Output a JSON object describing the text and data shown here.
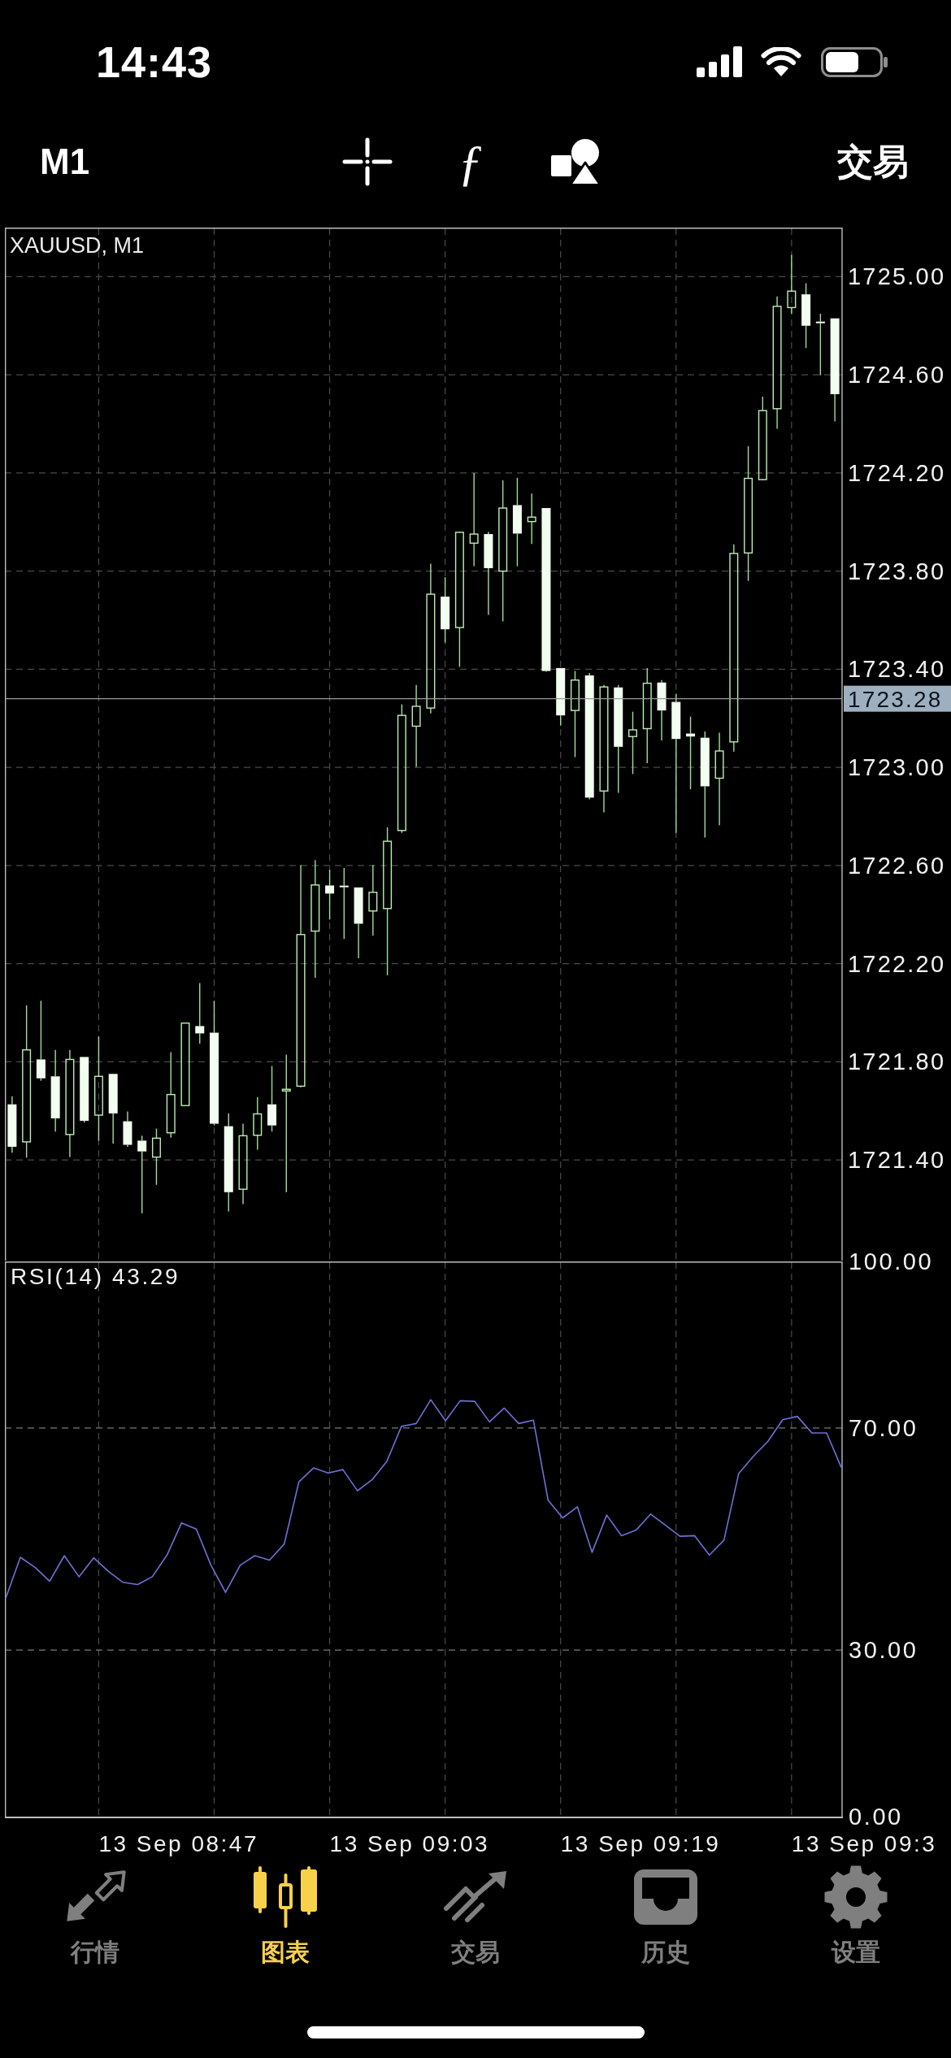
{
  "status_bar": {
    "time": "14:43"
  },
  "toolbar": {
    "timeframe": "M1",
    "function_glyph": "ƒ",
    "trade": "交易"
  },
  "chart": {
    "chart_data": {
      "type": "candlestick",
      "title": "XAUUSD, M1",
      "grid": true,
      "ylim": [
        1720.99,
        1725.2
      ],
      "yticks": [
        {
          "value": 1725.0,
          "label": "1725.00"
        },
        {
          "value": 1724.6,
          "label": "1724.60"
        },
        {
          "value": 1724.2,
          "label": "1724.20"
        },
        {
          "value": 1723.8,
          "label": "1723.80"
        },
        {
          "value": 1723.4,
          "label": "1723.40"
        },
        {
          "value": 1723.0,
          "label": "1723.00"
        },
        {
          "value": 1722.6,
          "label": "1722.60"
        },
        {
          "value": 1722.2,
          "label": "1722.20"
        },
        {
          "value": 1721.8,
          "label": "1721.80"
        },
        {
          "value": 1721.4,
          "label": "1721.40"
        }
      ],
      "ohlc": [
        [
          1721.627,
          1721.66,
          1721.43,
          1721.454
        ],
        [
          1721.474,
          1722.03,
          1721.41,
          1721.849
        ],
        [
          1721.81,
          1722.049,
          1721.723,
          1721.733
        ],
        [
          1721.741,
          1721.849,
          1721.516,
          1721.57
        ],
        [
          1721.504,
          1721.849,
          1721.412,
          1721.81
        ],
        [
          1721.82,
          1721.82,
          1721.553,
          1721.56
        ],
        [
          1721.583,
          1721.904,
          1721.479,
          1721.741
        ],
        [
          1721.751,
          1721.751,
          1721.467,
          1721.59
        ],
        [
          1721.558,
          1721.598,
          1721.454,
          1721.462
        ],
        [
          1721.479,
          1721.499,
          1721.183,
          1721.435
        ],
        [
          1721.412,
          1721.528,
          1721.299,
          1721.489
        ],
        [
          1721.511,
          1721.84,
          1721.491,
          1721.667
        ],
        [
          1721.622,
          1721.958,
          1721.622,
          1721.958
        ],
        [
          1721.946,
          1722.121,
          1721.874,
          1721.916
        ],
        [
          1721.919,
          1722.049,
          1721.541,
          1721.548
        ],
        [
          1721.538,
          1721.59,
          1721.19,
          1721.269
        ],
        [
          1721.281,
          1721.548,
          1721.22,
          1721.499
        ],
        [
          1721.501,
          1721.657,
          1721.442,
          1721.588
        ],
        [
          1721.627,
          1721.783,
          1721.516,
          1721.541
        ],
        [
          1721.683,
          1721.83,
          1721.269,
          1721.687
        ],
        [
          1721.701,
          1722.602,
          1721.696,
          1722.319
        ],
        [
          1722.333,
          1722.622,
          1722.143,
          1722.521
        ],
        [
          1722.519,
          1722.583,
          1722.38,
          1722.486
        ],
        [
          1722.516,
          1722.59,
          1722.301,
          1722.514
        ],
        [
          1722.511,
          1722.511,
          1722.222,
          1722.363
        ],
        [
          1722.415,
          1722.602,
          1722.314,
          1722.491
        ],
        [
          1722.425,
          1722.756,
          1722.153,
          1722.699
        ],
        [
          1722.743,
          1723.257,
          1722.733,
          1723.212
        ],
        [
          1723.168,
          1723.336,
          1723.002,
          1723.249
        ],
        [
          1723.242,
          1723.83,
          1723.22,
          1723.706
        ],
        [
          1723.696,
          1723.775,
          1723.509,
          1723.563
        ],
        [
          1723.57,
          1723.961,
          1723.41,
          1723.958
        ],
        [
          1723.914,
          1724.2,
          1723.82,
          1723.951
        ],
        [
          1723.951,
          1723.96,
          1723.622,
          1723.812
        ],
        [
          1723.8,
          1724.17,
          1723.595,
          1724.057
        ],
        [
          1724.069,
          1724.18,
          1723.82,
          1723.953
        ],
        [
          1724.002,
          1724.116,
          1723.911,
          1724.02
        ],
        [
          1724.057,
          1724.057,
          1723.39,
          1723.393
        ],
        [
          1723.405,
          1723.405,
          1723.17,
          1723.212
        ],
        [
          1723.232,
          1723.393,
          1723.042,
          1723.356
        ],
        [
          1723.375,
          1723.385,
          1722.87,
          1722.877
        ],
        [
          1722.904,
          1723.336,
          1722.817,
          1723.328
        ],
        [
          1723.326,
          1723.336,
          1722.896,
          1723.084
        ],
        [
          1723.126,
          1723.227,
          1722.973,
          1723.153
        ],
        [
          1723.158,
          1723.405,
          1723.017,
          1723.343
        ],
        [
          1723.346,
          1723.356,
          1723.11,
          1723.232
        ],
        [
          1723.267,
          1723.3,
          1722.733,
          1723.116
        ],
        [
          1723.138,
          1723.207,
          1722.911,
          1723.126
        ],
        [
          1723.121,
          1723.146,
          1722.714,
          1722.923
        ],
        [
          1722.956,
          1723.141,
          1722.765,
          1723.067
        ],
        [
          1723.104,
          1723.909,
          1723.064,
          1723.872
        ],
        [
          1723.874,
          1724.309,
          1723.76,
          1724.178
        ],
        [
          1724.173,
          1724.511,
          1724.17,
          1724.454
        ],
        [
          1724.462,
          1724.919,
          1724.38,
          1724.879
        ],
        [
          1724.874,
          1725.089,
          1724.849,
          1724.941
        ],
        [
          1724.928,
          1724.973,
          1724.709,
          1724.8
        ],
        [
          1724.815,
          1724.849,
          1724.598,
          1724.812
        ],
        [
          1724.83,
          1724.83,
          1724.41,
          1724.521
        ]
      ],
      "ref_lines": [
        {
          "axis": "y",
          "value": 1723.28,
          "label": "1723.28"
        }
      ]
    }
  },
  "indicator": {
    "chart_data": {
      "type": "line",
      "title": "RSI(14) 43.29",
      "grid": true,
      "ylim": [
        0,
        100
      ],
      "yticks": [
        {
          "value": 100,
          "label": "100.00"
        },
        {
          "value": 70,
          "label": "70.00"
        },
        {
          "value": 30,
          "label": "30.00"
        },
        {
          "value": 0,
          "label": "0.00"
        }
      ],
      "series": [
        {
          "color": "#6d72d9",
          "values": [
            39.3,
            46.7,
            44.9,
            42.4,
            47.0,
            43.2,
            46.6,
            44.2,
            42.2,
            41.8,
            43.2,
            47.1,
            52.9,
            51.8,
            45.3,
            40.4,
            45.3,
            47.0,
            46.2,
            49.1,
            60.3,
            62.8,
            61.9,
            62.5,
            58.7,
            60.7,
            64.0,
            70.3,
            70.8,
            75.1,
            71.3,
            74.9,
            74.8,
            71.1,
            73.6,
            70.8,
            71.4,
            57.0,
            53.8,
            55.8,
            47.6,
            54.3,
            50.6,
            51.6,
            54.5,
            52.5,
            50.5,
            50.6,
            47.1,
            49.8,
            61.8,
            64.9,
            67.6,
            71.5,
            72.1,
            69.1,
            69.1,
            62.9
          ]
        }
      ]
    }
  },
  "time_axis": {
    "labels": [
      "13 Sep 08:47",
      "13 Sep 09:03",
      "13 Sep 09:19",
      "13 Sep 09:3"
    ]
  },
  "tabs": [
    {
      "label": "行情",
      "selected": false
    },
    {
      "label": "图表",
      "selected": true
    },
    {
      "label": "交易",
      "selected": false
    },
    {
      "label": "历史",
      "selected": false
    },
    {
      "label": "设置",
      "selected": false
    }
  ]
}
